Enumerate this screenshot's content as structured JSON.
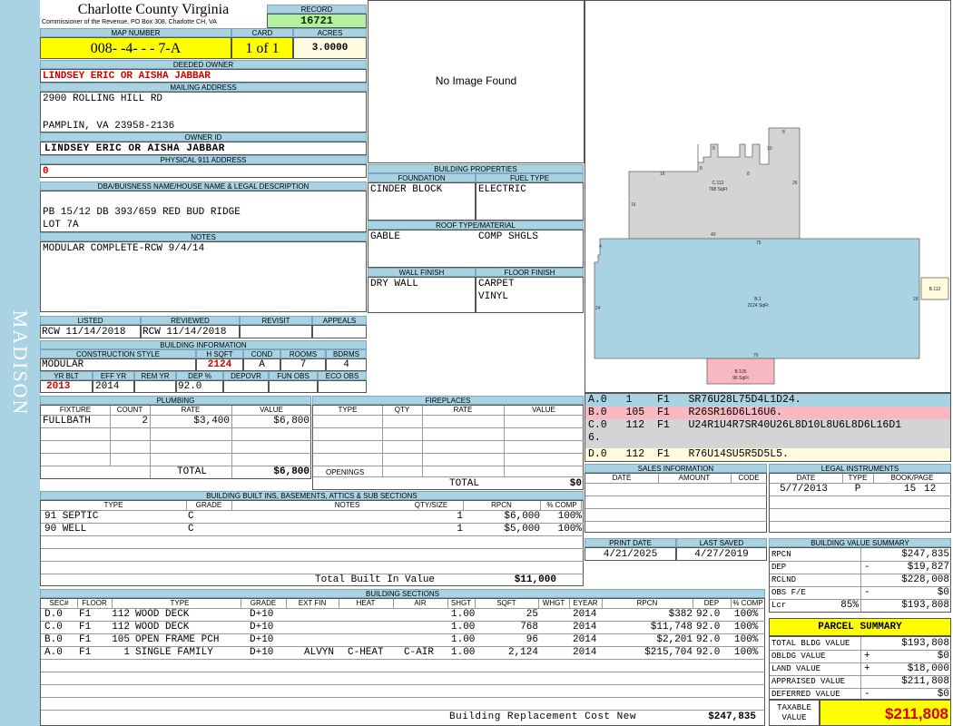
{
  "sidebar": {
    "district": "MADISON"
  },
  "header": {
    "county": "Charlotte County Virginia",
    "office": "Commissioner of the Revenue, PO Box 308, Charlotte CH, VA",
    "record_label": "RECORD",
    "record": "16721",
    "map_label": "MAP NUMBER",
    "map_number": "008- -4- - - 7-A",
    "card_label": "CARD",
    "card": "1 of 1",
    "acres_label": "ACRES",
    "acres": "3.0000"
  },
  "owner": {
    "deeded_label": "DEEDED OWNER",
    "deeded_owner": "LINDSEY ERIC OR AISHA JABBAR",
    "mailing_label": "MAILING ADDRESS",
    "address1": "2900 ROLLING HILL RD",
    "address2": "PAMPLIN, VA 23958-2136",
    "id_label": "OWNER ID",
    "owner_id": "LINDSEY ERIC OR AISHA JABBAR",
    "physical_label": "PHYSICAL 911 ADDRESS",
    "physical": "0"
  },
  "legal": {
    "label": "DBA/BUISNESS NAME/HOUSE NAME & LEGAL DESCRIPTION",
    "line1": "PB 15/12 DB 393/659 RED BUD RIDGE",
    "line2": "LOT 7A",
    "notes_label": "NOTES",
    "notes": "MODULAR COMPLETE-RCW 9/4/14"
  },
  "image": {
    "placeholder": "No Image Found"
  },
  "building_properties": {
    "label": "BUILDING PROPERTIES",
    "foundation_label": "FOUNDATION",
    "fuel_label": "FUEL TYPE",
    "foundation": "CINDER BLOCK",
    "fuel": "ELECTRIC",
    "roof_label": "ROOF TYPE/MATERIAL",
    "roof_type": "GABLE",
    "roof_material": "COMP SHGLS",
    "wall_label": "WALL FINISH",
    "floor_label": "FLOOR FINISH",
    "wall": "DRY WALL",
    "floor1": "CARPET",
    "floor2": "VINYL"
  },
  "review": {
    "listed_label": "LISTED",
    "reviewed_label": "REVIEWED",
    "revisit_label": "REVISIT",
    "appeals_label": "APPEALS",
    "listed": "RCW 11/14/2018",
    "reviewed": "RCW 11/14/2018"
  },
  "building_info": {
    "label": "BUILDING INFORMATION",
    "h_style": "CONSTRUCTION STYLE",
    "h_sqft": "H SQFT",
    "h_cond": "COND",
    "h_rooms": "ROOMS",
    "h_bdrms": "BDRMS",
    "style": "MODULAR",
    "sqft": "2124",
    "cond": "A",
    "rooms": "7",
    "bdrms": "4",
    "h_yrblt": "YR BLT",
    "h_effyr": "EFF YR",
    "h_remyr": "REM YR",
    "h_dep": "DEP %",
    "h_depovr": "DEPOVR",
    "h_funobs": "FUN OBS",
    "h_ecoobs": "ECO OBS",
    "yrblt": "2013",
    "effyr": "2014",
    "dep": "92.0"
  },
  "plumbing": {
    "label": "PLUMBING",
    "h_fixture": "FIXTURE",
    "h_count": "COUNT",
    "h_rate": "RATE",
    "h_value": "VALUE",
    "fixture": "FULLBATH",
    "count": "2",
    "rate": "$3,400",
    "value": "$6,800",
    "total_label": "TOTAL",
    "total": "$6,800"
  },
  "fireplaces": {
    "label": "FIREPLACES",
    "h_type": "TYPE",
    "h_qty": "QTY",
    "h_rate": "RATE",
    "h_value": "VALUE",
    "openings_label": "OPENINGS",
    "total_label": "TOTAL",
    "total": "$0"
  },
  "builtins": {
    "label": "BUILDING BUILT INS, BASEMENTS, ATTICS & SUB SECTIONS",
    "h_type": "TYPE",
    "h_grade": "GRADE",
    "h_notes": "NOTES",
    "h_qty": "QTY/SIZE",
    "h_rpcn": "RPCN",
    "h_comp": "% COMP",
    "rows": [
      {
        "type": "91 SEPTIC",
        "grade": "C",
        "qty": "1",
        "rpcn": "$6,000",
        "comp": "100%"
      },
      {
        "type": "90 WELL",
        "grade": "C",
        "qty": "1",
        "rpcn": "$5,000",
        "comp": "100%"
      }
    ],
    "total_label": "Total Built In Value",
    "total": "$11,000"
  },
  "sections": {
    "label": "BUILDING SECTIONS",
    "headers": [
      "SEC#",
      "FLOOR",
      "TYPE",
      "GRADE",
      "EXT FIN",
      "HEAT",
      "AIR",
      "SHGT",
      "SQFT",
      "WHGT",
      "EYEAR",
      "RPCN",
      "DEP",
      "% COMP"
    ],
    "rows": [
      {
        "sec": "D.0",
        "floor": "F1",
        "code": "112",
        "type": "WOOD DECK",
        "grade": "D+10",
        "ext": "",
        "heat": "",
        "air": "",
        "shgt": "1.00",
        "sqft": "25",
        "eyear": "2014",
        "rpcn": "$382",
        "dep": "92.0",
        "comp": "100%"
      },
      {
        "sec": "C.0",
        "floor": "F1",
        "code": "112",
        "type": "WOOD DECK",
        "grade": "D+10",
        "ext": "",
        "heat": "",
        "air": "",
        "shgt": "1.00",
        "sqft": "768",
        "eyear": "2014",
        "rpcn": "$11,748",
        "dep": "92.0",
        "comp": "100%"
      },
      {
        "sec": "B.0",
        "floor": "F1",
        "code": "105",
        "type": "OPEN FRAME PCH",
        "grade": "D+10",
        "ext": "",
        "heat": "",
        "air": "",
        "shgt": "1.00",
        "sqft": "96",
        "eyear": "2014",
        "rpcn": "$2,201",
        "dep": "92.0",
        "comp": "100%"
      },
      {
        "sec": "A.0",
        "floor": "F1",
        "code": "1",
        "type": "SINGLE FAMILY",
        "grade": "D+10",
        "ext": "ALVYN",
        "heat": "C-HEAT",
        "air": "C-AIR",
        "shgt": "1.00",
        "sqft": "2,124",
        "eyear": "2014",
        "rpcn": "$215,704",
        "dep": "92.0",
        "comp": "100%"
      }
    ],
    "total_label": "Building Replacement Cost New",
    "total": "$247,835"
  },
  "sketch": {
    "labels": {
      "a_name": "B.1",
      "a_area": "2124 SqFt",
      "c_name": "C.112",
      "c_area": "768 SqFt",
      "b_name": "B.105",
      "b_area": "96 SqFt",
      "d_name": "B.112",
      "d16a": "16",
      "d8a": "8",
      "d8b": "8",
      "d10": "10",
      "d8c": "8",
      "d16b": "16",
      "d8d": "8",
      "d26": "26",
      "d40": "40",
      "d16c": "16",
      "d75": "75",
      "d4": "4",
      "d24": "24",
      "d28": "28",
      "d76": "76"
    },
    "segments": [
      {
        "id": "A.0",
        "code": "1",
        "floor": "F1",
        "path": "SR76U28L75D4L1D24.",
        "color": "#a9d3e3"
      },
      {
        "id": "B.0",
        "code": "105",
        "floor": "F1",
        "path": "R26SR16D6L16U6.",
        "color": "#f7b8c2"
      },
      {
        "id": "C.0",
        "code": "112",
        "floor": "F1",
        "path": "U24R1U4R7SR40U26L8D10L8U6L8D6L16D1\n6.",
        "color": "#d4d4d4"
      },
      {
        "id": "D.0",
        "code": "112",
        "floor": "F1",
        "path": "R76U14SU5R5D5L5.",
        "color": "#fffbdc"
      }
    ]
  },
  "sales": {
    "label": "SALES INFORMATION",
    "h_date": "DATE",
    "h_amount": "AMOUNT",
    "h_code": "CODE"
  },
  "legal_instr": {
    "label": "LEGAL INSTRUMENTS",
    "h_date": "DATE",
    "h_type": "TYPE",
    "h_book": "BOOK/PAGE",
    "date": "5/7/2013",
    "type": "P",
    "book": "15",
    "page": "12"
  },
  "dates": {
    "print_label": "PRINT DATE",
    "saved_label": "LAST SAVED",
    "print": "4/21/2025",
    "saved": "4/27/2019"
  },
  "value_summary": {
    "label": "BUILDING VALUE SUMMARY",
    "rows": [
      {
        "label": "RPCN",
        "sign": "",
        "pct": "",
        "value": "$247,835"
      },
      {
        "label": "DEP",
        "sign": "-",
        "pct": "",
        "value": "$19,827"
      },
      {
        "label": "RCLND",
        "sign": "",
        "pct": "",
        "value": "$228,008"
      },
      {
        "label": "OBS F/E",
        "sign": "-",
        "pct": "",
        "value": "$0"
      },
      {
        "label": "Lcr",
        "sign": "",
        "pct": "85%",
        "value": "$193,808"
      }
    ]
  },
  "parcel_summary": {
    "label": "PARCEL SUMMARY",
    "rows": [
      {
        "label": "TOTAL BLDG VALUE",
        "sign": "",
        "value": "$193,808"
      },
      {
        "label": "OBLDG VALUE",
        "sign": "+",
        "value": "$0"
      },
      {
        "label": "LAND VALUE",
        "sign": "+",
        "value": "$18,000"
      },
      {
        "label": "APPRAISED VALUE",
        "sign": "",
        "value": "$211,808"
      },
      {
        "label": "DEFERRED VALUE",
        "sign": "-",
        "value": "$0"
      }
    ],
    "taxable_label1": "TAXABLE",
    "taxable_label2": "VALUE",
    "taxable": "$211,808"
  }
}
